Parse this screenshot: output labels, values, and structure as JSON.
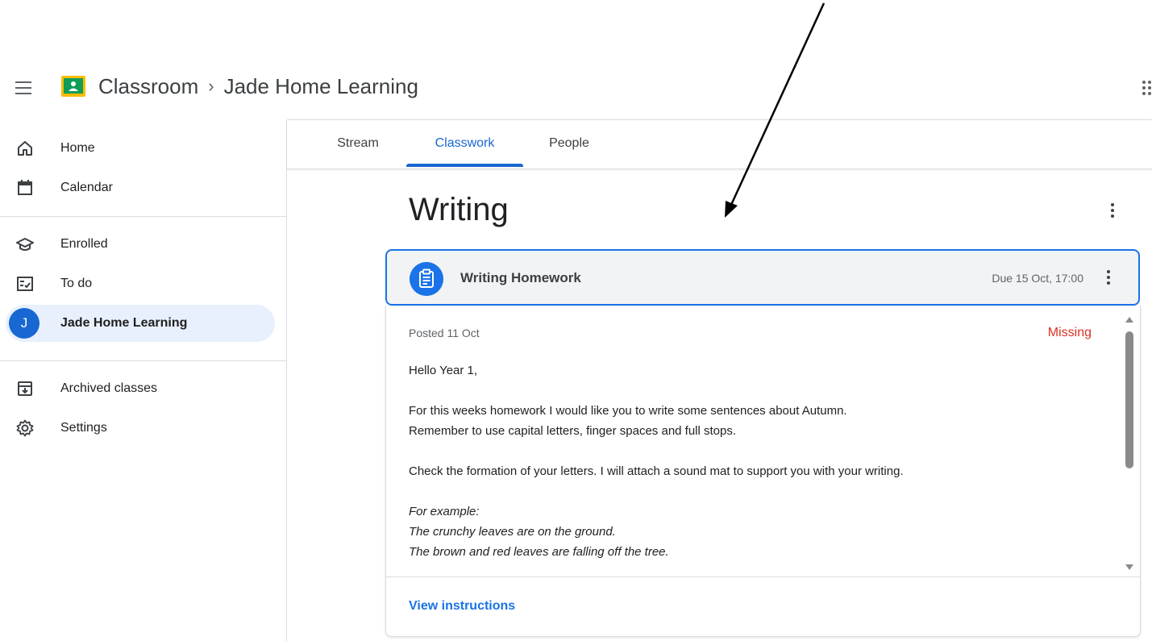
{
  "header": {
    "app_name": "Classroom",
    "separator": "›",
    "class_name": "Jade Home Learning"
  },
  "sidebar": {
    "items": [
      {
        "label": "Home",
        "icon": "home-icon"
      },
      {
        "label": "Calendar",
        "icon": "calendar-icon"
      },
      {
        "label": "Enrolled",
        "icon": "enrolled-icon"
      },
      {
        "label": "To do",
        "icon": "todo-icon"
      },
      {
        "label": "Jade Home Learning",
        "avatar_letter": "J",
        "active": true
      },
      {
        "label": "Archived classes",
        "icon": "archive-icon"
      },
      {
        "label": "Settings",
        "icon": "gear-icon"
      }
    ]
  },
  "tabs": [
    {
      "label": "Stream"
    },
    {
      "label": "Classwork",
      "active": true
    },
    {
      "label": "People"
    }
  ],
  "topic": {
    "title": "Writing"
  },
  "assignment": {
    "title": "Writing Homework",
    "due": "Due 15 Oct, 17:00",
    "posted": "Posted 11 Oct",
    "status": "Missing",
    "description": {
      "greeting": "Hello Year 1,",
      "line1": "For this weeks homework I would like you to write some sentences about Autumn.",
      "line2": "Remember to use capital letters, finger spaces and full stops.",
      "line3": "Check the formation of your letters. I will attach a sound mat to support you with your writing.",
      "example_intro": "For example:",
      "example1": "The crunchy leaves are on the ground.",
      "example2": "The brown and red leaves are falling off the tree."
    },
    "view_instructions": "View instructions"
  },
  "colors": {
    "accent": "#1967d2",
    "active_bg": "#e8f0fe",
    "missing": "#d93025",
    "divider": "#dadce0"
  }
}
